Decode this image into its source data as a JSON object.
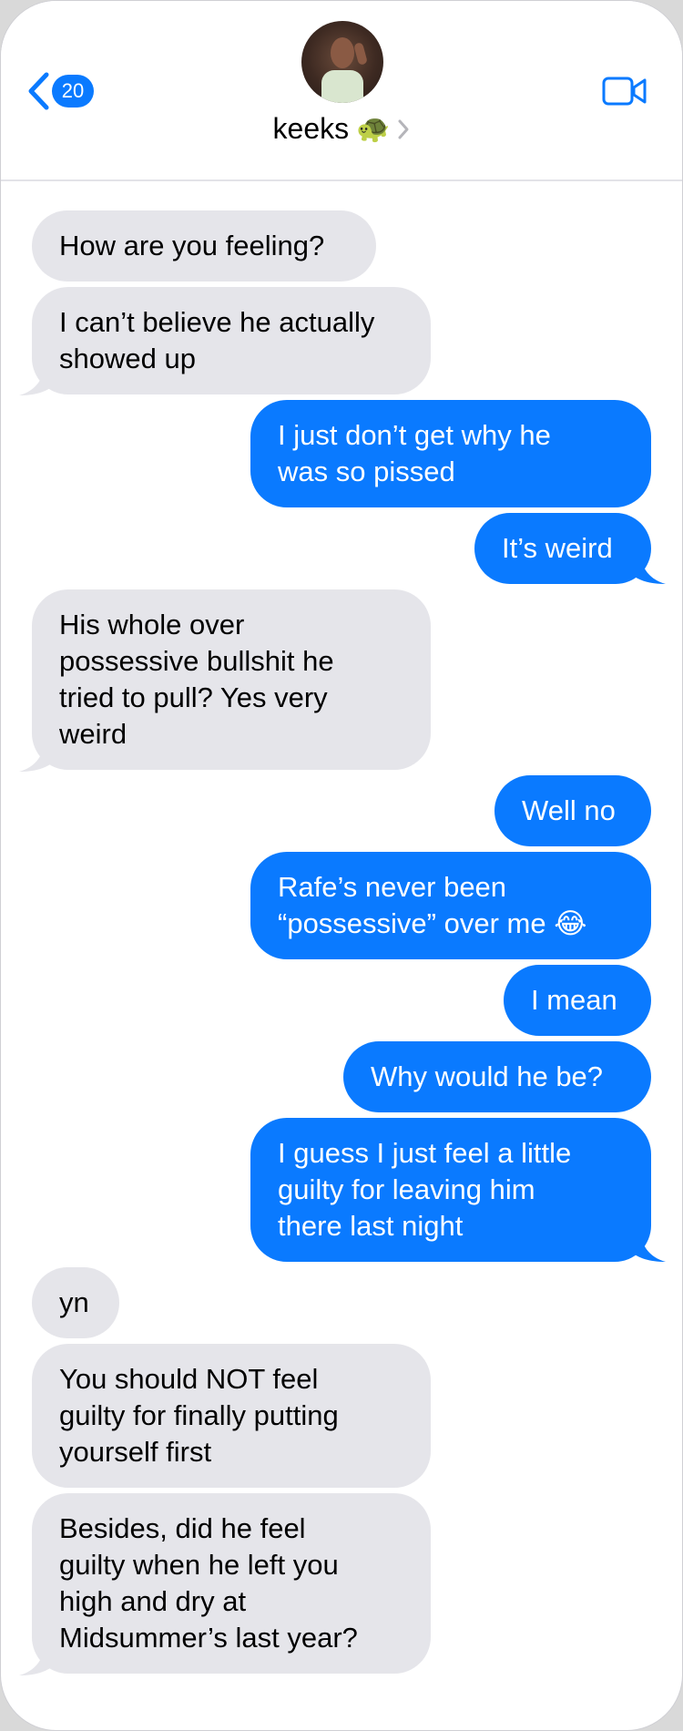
{
  "header": {
    "back_count": "20",
    "contact_name": "keeks",
    "contact_emoji": "🐢"
  },
  "messages": [
    {
      "from": "them",
      "text": "How are you feeling?"
    },
    {
      "from": "them",
      "text": "I can’t believe he actually\nshowed up"
    },
    {
      "from": "me",
      "text": "I just don’t get why he\nwas so pissed"
    },
    {
      "from": "me",
      "text": "It’s weird"
    },
    {
      "from": "them",
      "text": "His whole over\npossessive bullshit he\ntried to pull? Yes very\nweird"
    },
    {
      "from": "me",
      "text": "Well no"
    },
    {
      "from": "me",
      "text": "Rafe’s never been\n“possessive” over me 😂"
    },
    {
      "from": "me",
      "text": "I mean"
    },
    {
      "from": "me",
      "text": "Why would he be?"
    },
    {
      "from": "me",
      "text": "I guess I just feel a little\nguilty for leaving him\nthere last night"
    },
    {
      "from": "them",
      "text": "yn"
    },
    {
      "from": "them",
      "text": "You should NOT feel\nguilty for finally putting\nyourself first"
    },
    {
      "from": "them",
      "text": "Besides, did he feel\nguilty when he left you\nhigh and dry at\nMidsummer’s last year?"
    }
  ],
  "colors": {
    "outgoing_bubble": "#0a7aff",
    "incoming_bubble": "#e5e5ea",
    "accent": "#0a7aff"
  },
  "icons": [
    "chevron-left-icon",
    "video-camera-icon",
    "chevron-right-icon"
  ]
}
